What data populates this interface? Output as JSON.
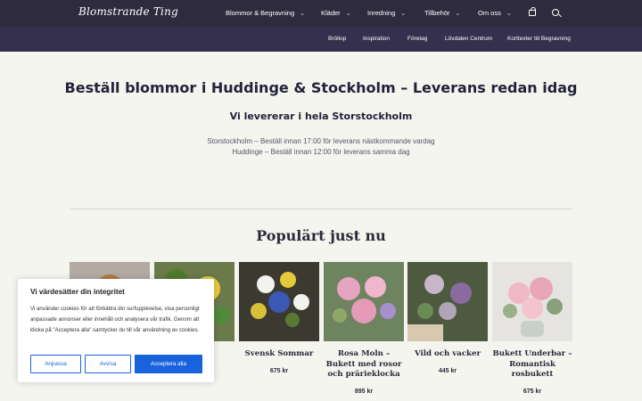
{
  "header": {
    "logo": "Blomstrande Ting",
    "nav": [
      {
        "label": "Blommor & Begravning",
        "has_dropdown": true
      },
      {
        "label": "Kläder",
        "has_dropdown": true
      },
      {
        "label": "Inredning",
        "has_dropdown": true
      },
      {
        "label": "Tillbehör",
        "has_dropdown": true
      },
      {
        "label": "Om oss",
        "has_dropdown": true
      }
    ],
    "icons": [
      "shopping-bag-icon",
      "search-icon"
    ]
  },
  "subnav": [
    "Bröllop",
    "Inspiration",
    "Företag",
    "Lövdalen Centrum",
    "Korttexter till Begravning"
  ],
  "hero": {
    "title": "Beställ blommor i Huddinge & Stockholm – Leverans redan idag",
    "subtitle": "Vi levererar i hela Storstockholm",
    "lines": [
      "Storstockholm – Beställ innan 17:00 för leverans nästkommande vardag",
      "Huddinge – Beställ innan 12:00 för leverans samma dag"
    ]
  },
  "popular": {
    "title": "Populärt just nu",
    "products": [
      {
        "name": "",
        "price": ""
      },
      {
        "name": "",
        "price": ""
      },
      {
        "name": "Svensk Sommar",
        "price": "675 kr"
      },
      {
        "name": "Rosa Moln – Bukett med rosor och prärieklocka",
        "price": "895 kr"
      },
      {
        "name": "Vild och vacker",
        "price": "445 kr"
      },
      {
        "name": "Bukett Underbar – Romantisk rosbukett",
        "price": "675 kr"
      }
    ]
  },
  "cookie_banner": {
    "title": "Vi värdesätter din integritet",
    "text": "Vi använder cookies för att förbättra din surfupplevelse, visa personligt anpassade annonser eller innehåll och analysera vår trafik. Genom att klicka på \"Acceptera alla\" samtycker du till vår användning av cookies.",
    "buttons": {
      "customize": "Anpassa",
      "reject": "Avvisa",
      "accept": "Acceptera alla"
    },
    "accent_color": "#1863dc"
  },
  "colors": {
    "header_bg": "#2e2b3f",
    "subnav_bg": "#34304d",
    "page_bg": "#f4f5ef"
  }
}
